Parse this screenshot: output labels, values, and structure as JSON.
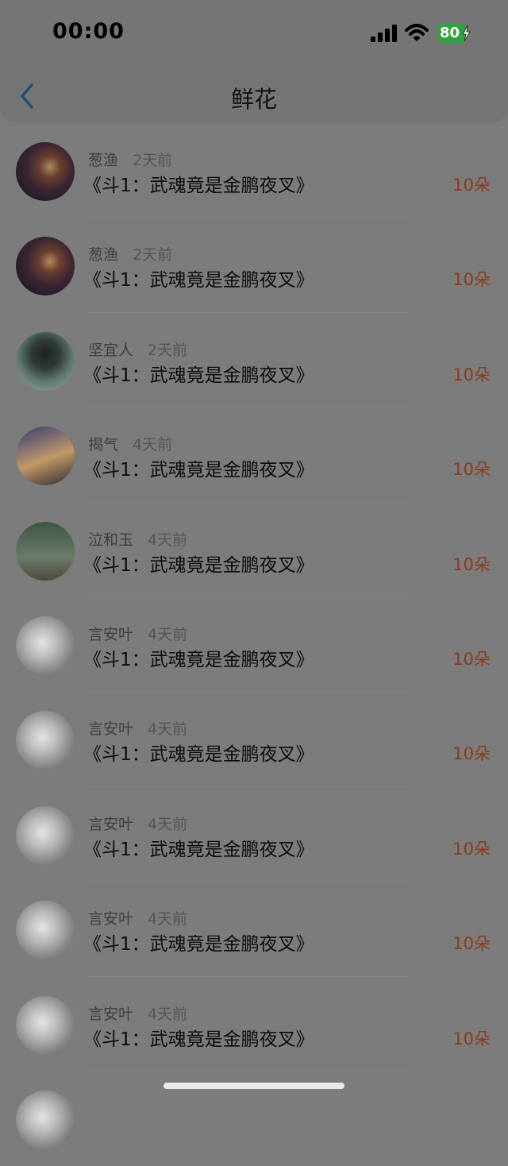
{
  "status": {
    "time": "00:00",
    "battery": "80"
  },
  "nav": {
    "title": "鲜花"
  },
  "rows": [
    {
      "name": "葱渔",
      "time": "2天前",
      "title": "《斗1：武魂竟是金鹏夜叉》",
      "count": "10朵",
      "avatar": "dark"
    },
    {
      "name": "葱渔",
      "time": "2天前",
      "title": "《斗1：武魂竟是金鹏夜叉》",
      "count": "10朵",
      "avatar": "dark"
    },
    {
      "name": "坚宜人",
      "time": "2天前",
      "title": "《斗1：武魂竟是金鹏夜叉》",
      "count": "10朵",
      "avatar": "green"
    },
    {
      "name": "揭气",
      "time": "4天前",
      "title": "《斗1：武魂竟是金鹏夜叉》",
      "count": "10朵",
      "avatar": "sunset"
    },
    {
      "name": "泣和玉",
      "time": "4天前",
      "title": "《斗1：武魂竟是金鹏夜叉》",
      "count": "10朵",
      "avatar": "room"
    },
    {
      "name": "言安叶",
      "time": "4天前",
      "title": "《斗1：武魂竟是金鹏夜叉》",
      "count": "10朵",
      "avatar": "manga"
    },
    {
      "name": "言安叶",
      "time": "4天前",
      "title": "《斗1：武魂竟是金鹏夜叉》",
      "count": "10朵",
      "avatar": "manga"
    },
    {
      "name": "言安叶",
      "time": "4天前",
      "title": "《斗1：武魂竟是金鹏夜叉》",
      "count": "10朵",
      "avatar": "manga"
    },
    {
      "name": "言安叶",
      "time": "4天前",
      "title": "《斗1：武魂竟是金鹏夜叉》",
      "count": "10朵",
      "avatar": "manga"
    },
    {
      "name": "言安叶",
      "time": "4天前",
      "title": "《斗1：武魂竟是金鹏夜叉》",
      "count": "10朵",
      "avatar": "manga"
    }
  ],
  "colors": {
    "accent": "#8a3c1c",
    "back_arrow": "#1c4f7e"
  }
}
